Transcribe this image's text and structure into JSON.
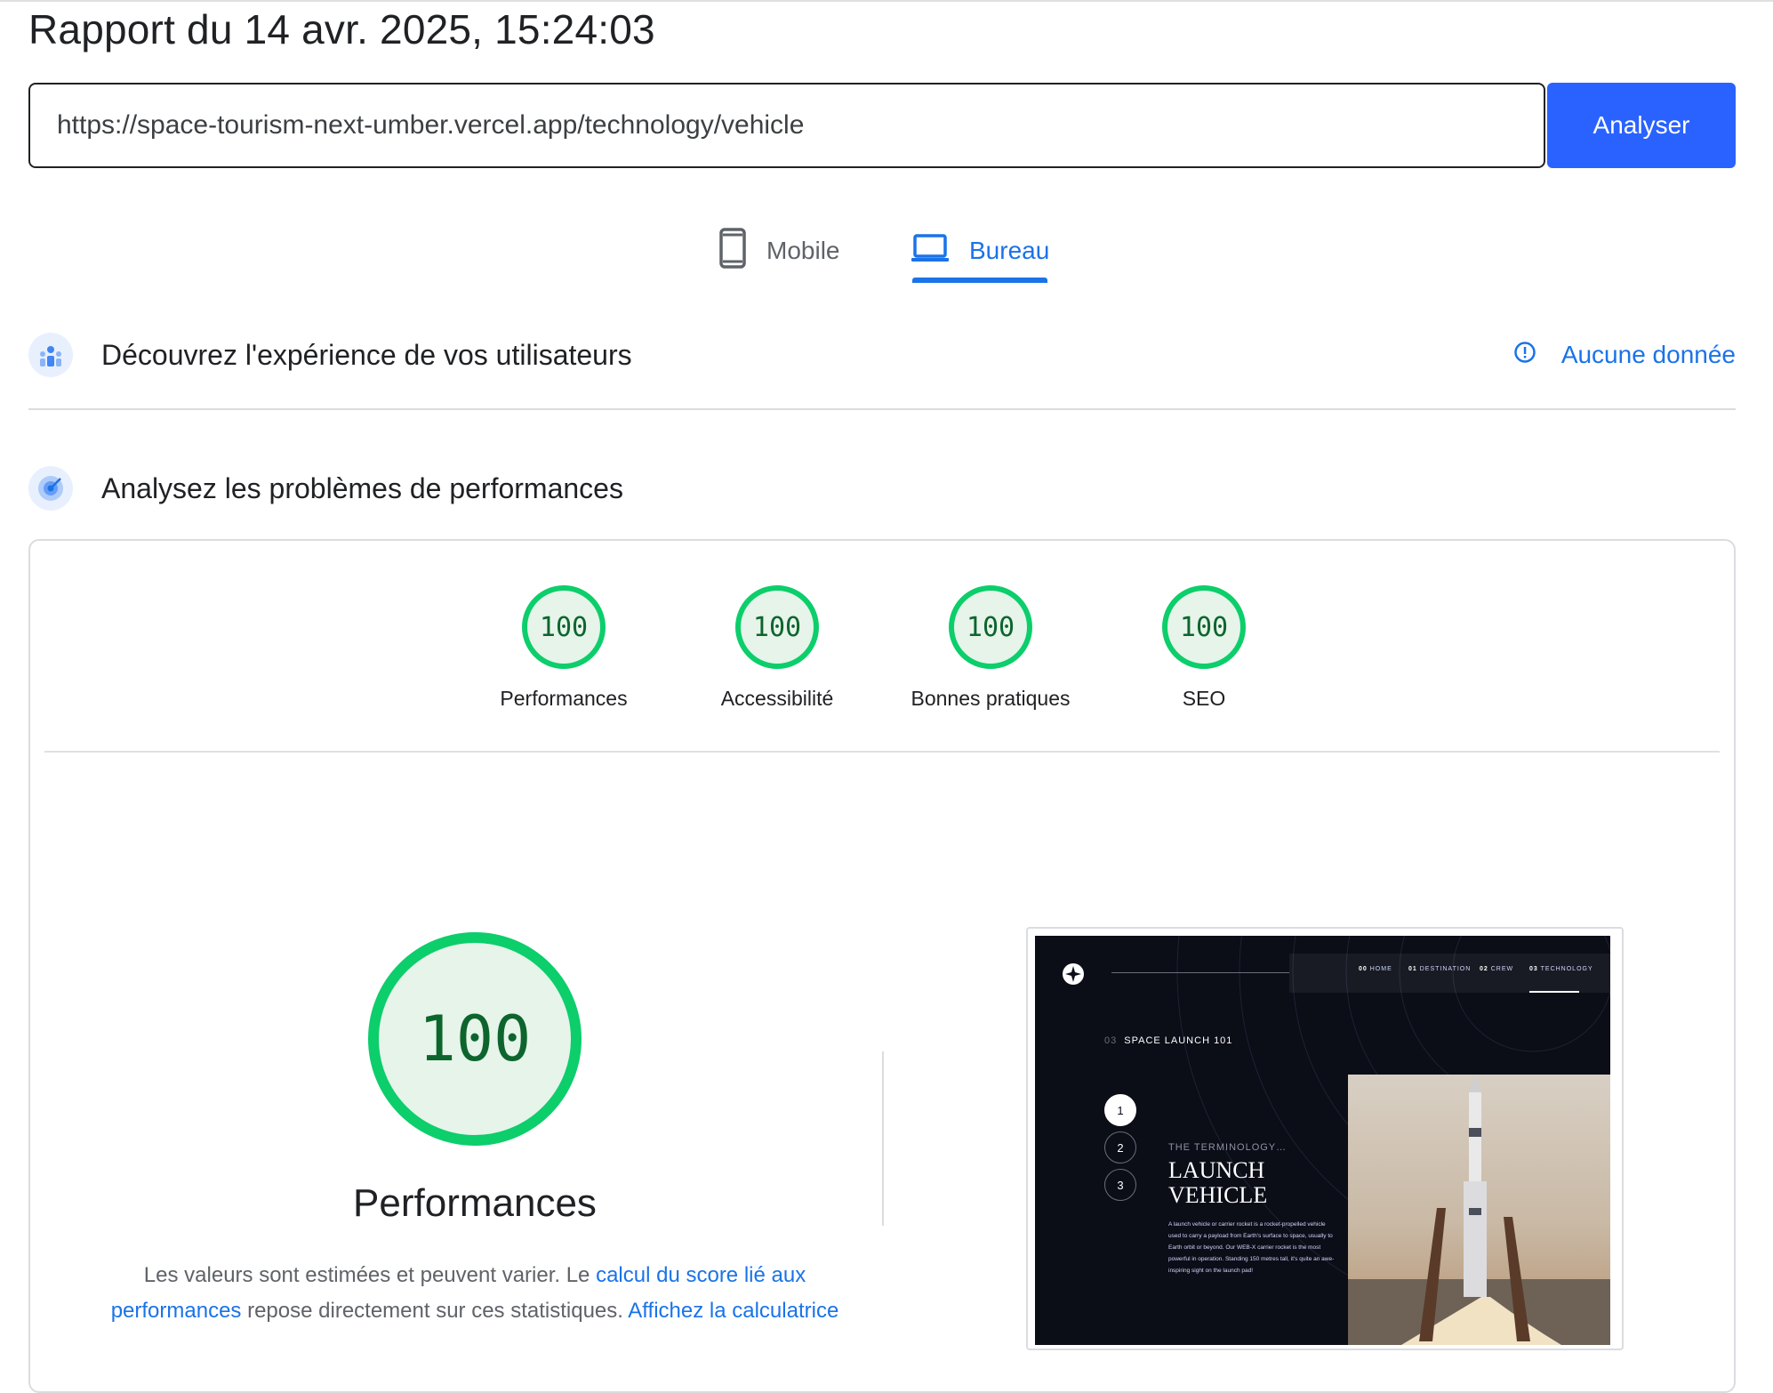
{
  "report": {
    "title": "Rapport du 14 avr. 2025, 15:24:03"
  },
  "search": {
    "url": "https://space-tourism-next-umber.vercel.app/technology/vehicle",
    "button": "Analyser"
  },
  "tabs": [
    {
      "label": "Mobile",
      "icon": "smartphone-icon",
      "active": false
    },
    {
      "label": "Bureau",
      "icon": "laptop-icon",
      "active": true
    }
  ],
  "field_data": {
    "title": "Découvrez l'expérience de vos utilisateurs",
    "status": "Aucune donnée",
    "icon": "users-chart-icon",
    "status_icon": "info-icon"
  },
  "lab_data": {
    "title": "Analysez les problèmes de performances",
    "icon": "radar-icon"
  },
  "scores": [
    {
      "label": "Performances",
      "score": "100"
    },
    {
      "label": "Accessibilité",
      "score": "100"
    },
    {
      "label": "Bonnes pratiques",
      "score": "100"
    },
    {
      "label": "SEO",
      "score": "100"
    }
  ],
  "performance": {
    "score": "100",
    "title": "Performances",
    "desc_1": "Les valeurs sont estimées et peuvent varier. Le ",
    "link_1": "calcul du score lié aux performances",
    "desc_2": " repose directement sur ces statistiques. ",
    "link_2": "Affichez la calculatrice"
  },
  "colors": {
    "pass": "#0cce6b",
    "pass_bg": "#e6f4ea",
    "pass_text": "#0d652d",
    "accent": "#1a73e8",
    "button": "#2962ff"
  },
  "screenshot": {
    "nav": [
      {
        "num": "00",
        "label": "HOME"
      },
      {
        "num": "01",
        "label": "DESTINATION"
      },
      {
        "num": "02",
        "label": "CREW"
      },
      {
        "num": "03",
        "label": "TECHNOLOGY"
      }
    ],
    "subtitle_num": "03",
    "subtitle": "SPACE LAUNCH 101",
    "steps": [
      "1",
      "2",
      "3"
    ],
    "terminology": "THE TERMINOLOGY…",
    "heading": "LAUNCH VEHICLE",
    "paragraph": "A launch vehicle or carrier rocket is a rocket-propelled vehicle used to carry a payload from Earth's surface to space, usually to Earth orbit or beyond. Our WEB-X carrier rocket is the most powerful in operation. Standing 150 metres tall, it's quite an awe-inspiring sight on the launch pad!"
  }
}
